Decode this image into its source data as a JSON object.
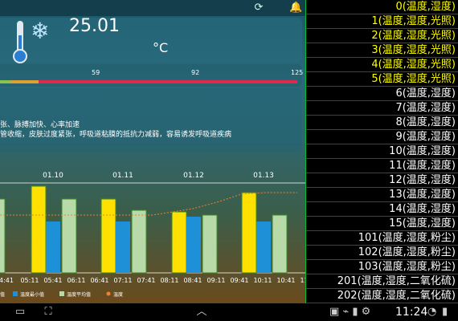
{
  "header": {
    "icon_left": "refresh-icon",
    "icon_right": "bell-icon"
  },
  "temperature": {
    "value": "25.01",
    "unit": "°C"
  },
  "scale": {
    "ticks": [
      "59",
      "92",
      "125"
    ]
  },
  "advice": {
    "line1": "张、脉搏加快、心率加速",
    "line2": "管收缩，皮肤过度紧张，呼吸道粘膜的抵抗力减弱，容易诱发呼吸道疾病"
  },
  "chart_data": {
    "type": "bar",
    "date_labels": [
      "01.10",
      "01.11",
      "01.12",
      "01.13"
    ],
    "categories": [
      "4:41",
      "05:11",
      "05:41",
      "06:11",
      "06:41",
      "07:11",
      "07:41",
      "08:11",
      "08:41",
      "09:11",
      "09:41",
      "10:11",
      "10:41",
      "11:11"
    ],
    "series": [
      {
        "name": "最高值",
        "color": "#ffe000"
      },
      {
        "name": "温度最小值",
        "color": "#1e90d8"
      },
      {
        "name": "温度平均值",
        "color": "#b8d9a8"
      },
      {
        "name": "温度",
        "color": "#f08030"
      }
    ],
    "legend": [
      "值",
      "温度最小值",
      "温度平均值",
      "温度"
    ]
  },
  "sidebar": {
    "items": [
      {
        "label": "0(温度,湿度)",
        "color": "#ffff00"
      },
      {
        "label": "1(温度,湿度,光照)",
        "color": "#ffff00"
      },
      {
        "label": "2(温度,湿度,光照)",
        "color": "#ffff00"
      },
      {
        "label": "3(温度,湿度,光照)",
        "color": "#ffff00"
      },
      {
        "label": "4(温度,湿度,光照)",
        "color": "#ffff00"
      },
      {
        "label": "5(温度,湿度,光照)",
        "color": "#ffff00"
      },
      {
        "label": "6(温度,湿度)",
        "color": "#ffffff"
      },
      {
        "label": "7(温度,湿度)",
        "color": "#ffffff"
      },
      {
        "label": "8(温度,湿度)",
        "color": "#ffffff"
      },
      {
        "label": "9(温度,湿度)",
        "color": "#ffffff"
      },
      {
        "label": "10(温度,湿度)",
        "color": "#ffffff"
      },
      {
        "label": "11(温度,湿度)",
        "color": "#ffffff"
      },
      {
        "label": "12(温度,湿度)",
        "color": "#ffffff"
      },
      {
        "label": "13(温度,湿度)",
        "color": "#ffffff"
      },
      {
        "label": "14(温度,湿度)",
        "color": "#ffffff"
      },
      {
        "label": "15(温度,湿度)",
        "color": "#ffffff"
      },
      {
        "label": "101(温度,湿度,粉尘)",
        "color": "#ffffff"
      },
      {
        "label": "102(温度,湿度,粉尘)",
        "color": "#ffffff"
      },
      {
        "label": "103(温度,湿度,粉尘)",
        "color": "#ffffff"
      },
      {
        "label": "201(温度,湿度,二氧化硫)",
        "color": "#ffffff"
      },
      {
        "label": "202(温度,湿度,二氧化硫)",
        "color": "#ffffff"
      }
    ]
  },
  "statusbar": {
    "time": "11:24",
    "icons": [
      "usb-icon",
      "wifi-icon",
      "battery-icon"
    ]
  },
  "nav": {
    "back": "back-icon",
    "home": "home-icon",
    "recent": "recent-apps-icon"
  }
}
